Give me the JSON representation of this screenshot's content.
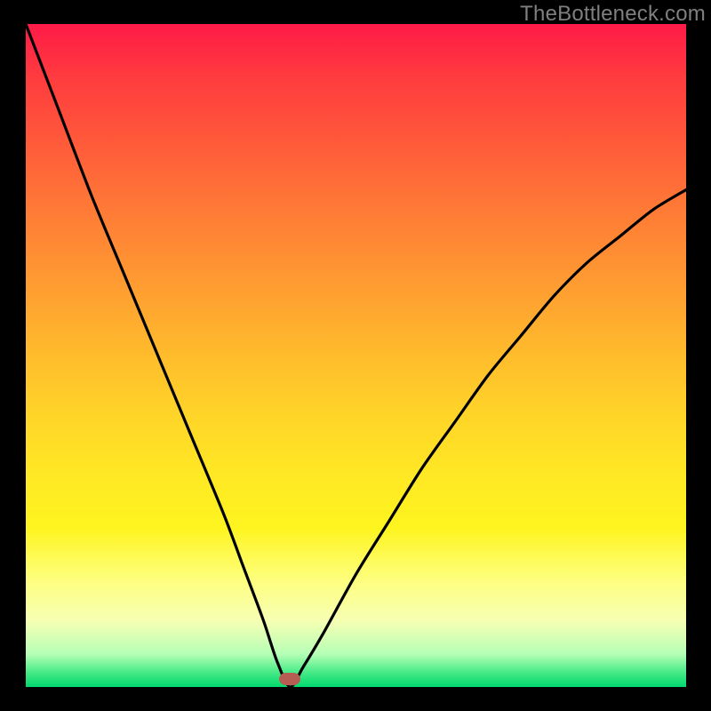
{
  "watermark": "TheBottleneck.com",
  "colors": {
    "gradient_top": "#ff1a47",
    "gradient_bottom": "#00d86e",
    "curve": "#000000",
    "marker": "#b55c53",
    "frame": "#000000"
  },
  "chart_data": {
    "type": "line",
    "title": "",
    "xlabel": "",
    "ylabel": "",
    "xlim": [
      0,
      100
    ],
    "ylim": [
      0,
      100
    ],
    "min_point": {
      "x": 40,
      "y": 0
    },
    "series": [
      {
        "name": "bottleneck-curve",
        "x": [
          0,
          5,
          10,
          15,
          20,
          25,
          30,
          33,
          36,
          38,
          40,
          42,
          45,
          50,
          55,
          60,
          65,
          70,
          75,
          80,
          85,
          90,
          95,
          100
        ],
        "y": [
          100,
          87,
          74,
          62,
          50,
          38,
          26,
          18,
          10,
          4,
          0,
          3,
          8,
          17,
          25,
          33,
          40,
          47,
          53,
          59,
          64,
          68,
          72,
          75
        ]
      }
    ],
    "marker": {
      "x": 40,
      "y": 1.2
    }
  }
}
